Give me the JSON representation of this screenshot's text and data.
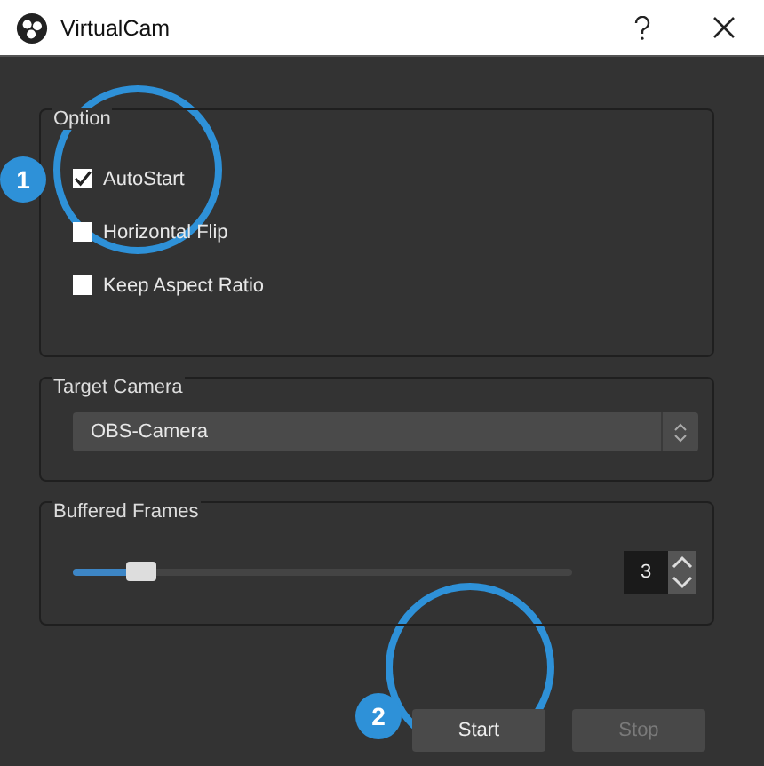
{
  "window": {
    "title": "VirtualCam"
  },
  "option_group": {
    "title": "Option",
    "checkboxes": [
      {
        "label": "AutoStart",
        "checked": true
      },
      {
        "label": "Horizontal Flip",
        "checked": false
      },
      {
        "label": "Keep Aspect Ratio",
        "checked": false
      }
    ]
  },
  "target_camera": {
    "title": "Target Camera",
    "value": "OBS-Camera"
  },
  "buffered_frames": {
    "title": "Buffered Frames",
    "level": 0.12,
    "value": "3"
  },
  "buttons": [
    {
      "label": "Start",
      "disabled": false
    },
    {
      "label": "Stop",
      "disabled": true
    }
  ],
  "annotations": [
    {
      "number": "1"
    },
    {
      "number": "2"
    }
  ]
}
